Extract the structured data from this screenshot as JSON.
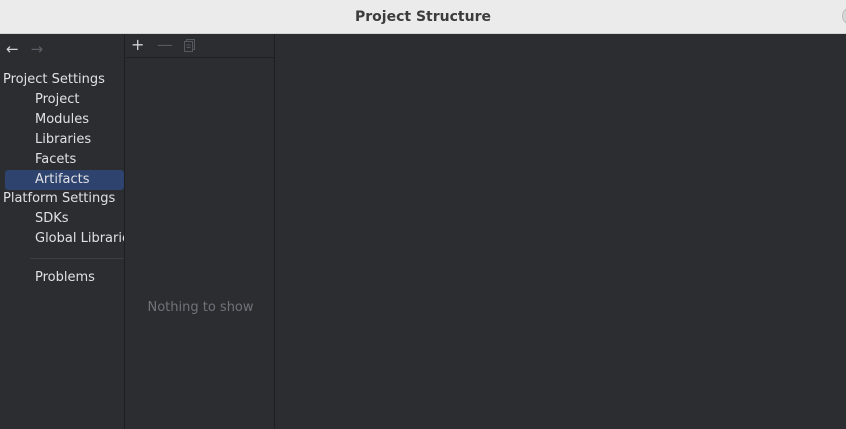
{
  "window": {
    "title": "Project Structure"
  },
  "nav": {
    "back_icon": "arrow-left-icon",
    "forward_icon": "arrow-right-icon"
  },
  "sidebar": {
    "project_settings_header": "Project Settings",
    "project_settings_items": [
      {
        "label": "Project",
        "selected": false
      },
      {
        "label": "Modules",
        "selected": false
      },
      {
        "label": "Libraries",
        "selected": false
      },
      {
        "label": "Facets",
        "selected": false
      },
      {
        "label": "Artifacts",
        "selected": true
      }
    ],
    "platform_settings_header": "Platform Settings",
    "platform_settings_items": [
      {
        "label": "SDKs"
      },
      {
        "label": "Global Librarie"
      }
    ],
    "problems_label": "Problems"
  },
  "toolbar": {
    "add_icon": "plus-icon",
    "remove_icon": "minus-icon",
    "copy_icon": "copy-icon"
  },
  "list": {
    "empty_text": "Nothing to show"
  },
  "colors": {
    "background": "#2b2d30",
    "selection": "#2e436e",
    "text": "#dfe1e5",
    "muted_text": "#6f737a",
    "titlebar": "#ebebeb"
  }
}
